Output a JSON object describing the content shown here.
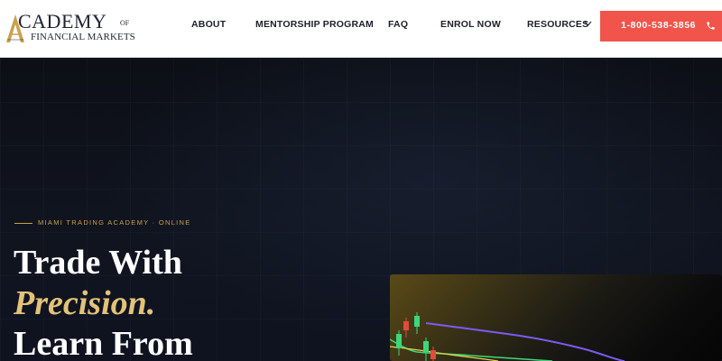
{
  "brand": {
    "logo_word": "CADEMY",
    "logo_of": "OF",
    "logo_sub": "FINANCIAL MARKETS",
    "accent_gold": "#c9a24e"
  },
  "nav": {
    "items": [
      {
        "label": "ABOUT"
      },
      {
        "label": "MENTORSHIP PROGRAM"
      },
      {
        "label": "FAQ"
      },
      {
        "label": "ENROL NOW"
      },
      {
        "label": "RESOURCES"
      }
    ],
    "resources_icon": "chevron-down-icon"
  },
  "cta": {
    "phone": "1-800-538-3856",
    "icon": "phone-icon",
    "color": "#f0544a"
  },
  "hero": {
    "eyebrow": "MIAMI TRADING ACADEMY · ONLINE",
    "heading_line1": "Trade With",
    "heading_line2": "Precision.",
    "heading_line3": "Learn From"
  }
}
